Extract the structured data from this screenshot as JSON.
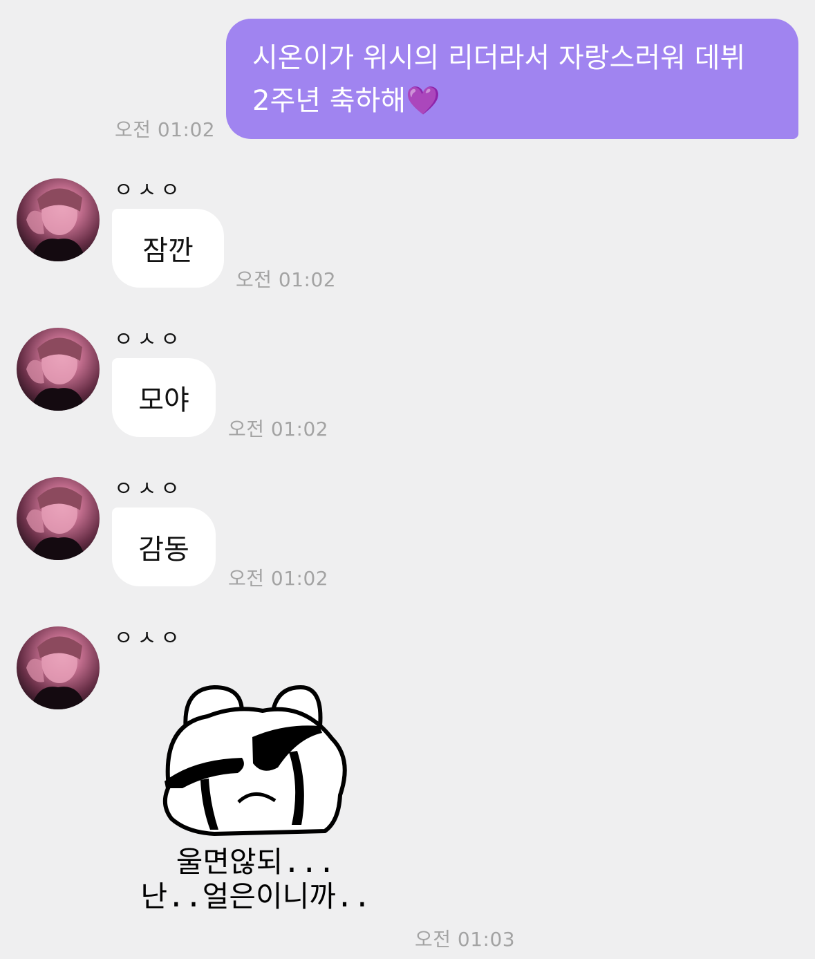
{
  "sent": {
    "line1": "시온이가 위시의 리더라서 자랑스러워 데뷔",
    "line2": "2주년 축하해",
    "emoji": "💜",
    "time": "오전 01:02",
    "bubble_color": "#a084f0"
  },
  "received": [
    {
      "sender": "ㅇㅅㅇ",
      "text": "잠깐",
      "time": "오전 01:02"
    },
    {
      "sender": "ㅇㅅㅇ",
      "text": "모야",
      "time": "오전 01:02"
    },
    {
      "sender": "ㅇㅅㅇ",
      "text": "감동",
      "time": "오전 01:02"
    },
    {
      "sender": "ㅇㅅㅇ",
      "time": "오전 01:03"
    }
  ],
  "sticker": {
    "icon": "crying-bear-sticker",
    "line1": "울면않되...",
    "line2": "난..얼은이니까.."
  },
  "colors": {
    "background": "#efeff0",
    "received_bubble": "#ffffff",
    "timestamp": "#a3a3a3"
  }
}
